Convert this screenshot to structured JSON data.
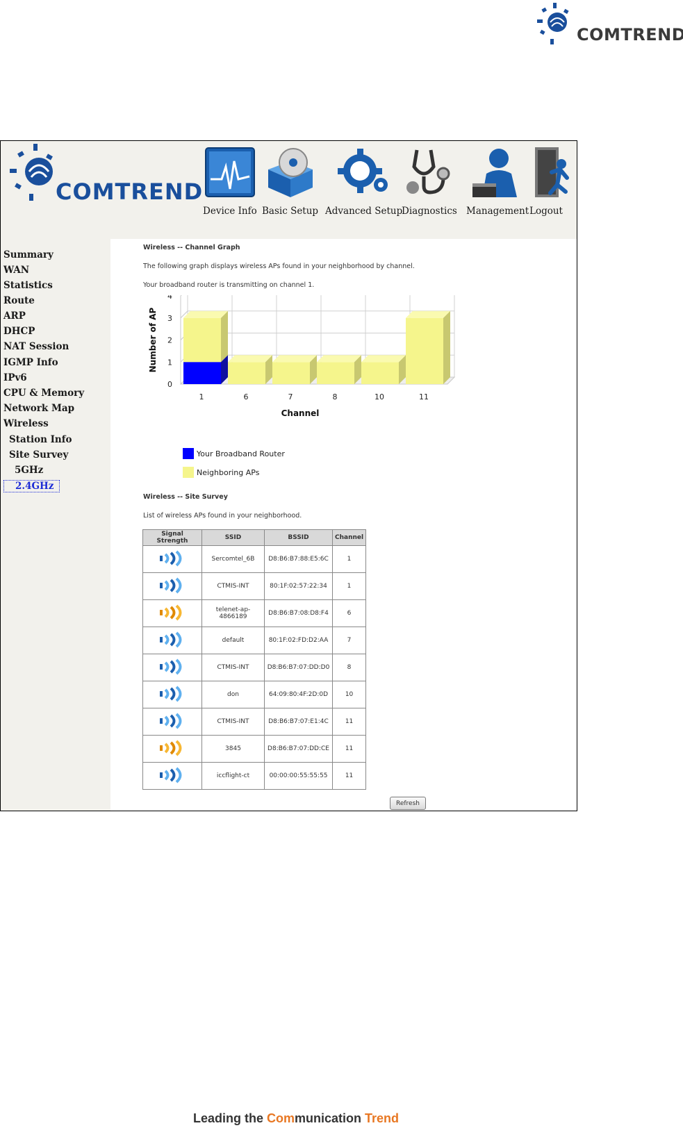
{
  "brand": {
    "name": "COMTREND",
    "footer_part1": "Leading the ",
    "footer_highlight": "Com",
    "footer_part2": "munication ",
    "footer_highlight2": "Trend"
  },
  "nav": [
    {
      "label": "Device Info",
      "icon": "device-info-icon"
    },
    {
      "label": "Basic Setup",
      "icon": "basic-setup-icon"
    },
    {
      "label": "Advanced Setup",
      "icon": "advanced-setup-icon"
    },
    {
      "label": "Diagnostics",
      "icon": "diagnostics-icon"
    },
    {
      "label": "Management",
      "icon": "management-icon"
    },
    {
      "label": "Logout",
      "icon": "logout-icon"
    }
  ],
  "sidebar": [
    {
      "label": "Summary"
    },
    {
      "label": "WAN"
    },
    {
      "label": "Statistics"
    },
    {
      "label": "Route"
    },
    {
      "label": "ARP"
    },
    {
      "label": "DHCP"
    },
    {
      "label": "NAT Session"
    },
    {
      "label": "IGMP Info"
    },
    {
      "label": "IPv6"
    },
    {
      "label": "CPU & Memory"
    },
    {
      "label": "Network Map"
    },
    {
      "label": "Wireless"
    },
    {
      "label": "Station Info"
    },
    {
      "label": "Site Survey"
    },
    {
      "label": "5GHz"
    },
    {
      "label": "2.4GHz"
    }
  ],
  "graph_section": {
    "title": "Wireless -- Channel Graph",
    "desc1": "The following graph displays wireless APs found in your neighborhood by channel.",
    "desc2": "Your broadband router is transmitting on channel 1."
  },
  "legend": {
    "router": "Your Broadband Router",
    "neighbors": "Neighboring APs"
  },
  "chart_data": {
    "type": "bar",
    "categories": [
      "1",
      "6",
      "7",
      "8",
      "10",
      "11"
    ],
    "series": [
      {
        "name": "Your Broadband Router",
        "values": [
          1,
          0,
          0,
          0,
          0,
          0
        ]
      },
      {
        "name": "Neighboring APs",
        "values": [
          2,
          1,
          1,
          1,
          1,
          3
        ]
      }
    ],
    "stacked": true,
    "xlabel": "Channel",
    "ylabel": "Number of AP",
    "ylim": [
      0,
      4
    ],
    "yticks": [
      "0",
      "1",
      "2",
      "3",
      "4"
    ],
    "grid": true,
    "colors": {
      "router": "#0000ff",
      "neighbors": "#f5f58c"
    }
  },
  "survey_section": {
    "title": "Wireless -- Site Survey",
    "desc": "List of wireless APs found in your neighborhood.",
    "headers": [
      "Signal Strength",
      "SSID",
      "BSSID",
      "Channel"
    ],
    "rows": [
      {
        "signal": "blue",
        "ssid": "Sercomtel_6B",
        "bssid": "D8:B6:B7:88:E5:6C",
        "channel": "1"
      },
      {
        "signal": "blue",
        "ssid": "CTMIS-INT",
        "bssid": "80:1F:02:57:22:34",
        "channel": "1"
      },
      {
        "signal": "orange",
        "ssid": "telenet-ap-4866189",
        "bssid": "D8:B6:B7:08:D8:F4",
        "channel": "6"
      },
      {
        "signal": "blue",
        "ssid": "default",
        "bssid": "80:1F:02:FD:D2:AA",
        "channel": "7"
      },
      {
        "signal": "blue",
        "ssid": "CTMIS-INT",
        "bssid": "D8:B6:B7:07:DD:D0",
        "channel": "8"
      },
      {
        "signal": "blue",
        "ssid": "don",
        "bssid": "64:09:80:4F:2D:0D",
        "channel": "10"
      },
      {
        "signal": "blue",
        "ssid": "CTMIS-INT",
        "bssid": "D8:B6:B7:07:E1:4C",
        "channel": "11"
      },
      {
        "signal": "orange",
        "ssid": "3845",
        "bssid": "D8:B6:B7:07:DD:CE",
        "channel": "11"
      },
      {
        "signal": "blue",
        "ssid": "iccflight-ct",
        "bssid": "00:00:00:55:55:55",
        "channel": "11"
      }
    ]
  },
  "refresh_label": "Refresh",
  "colors": {
    "brand_blue": "#1a4f9c",
    "selected": "#1c2bd6",
    "footer_orange": "#e87722"
  }
}
